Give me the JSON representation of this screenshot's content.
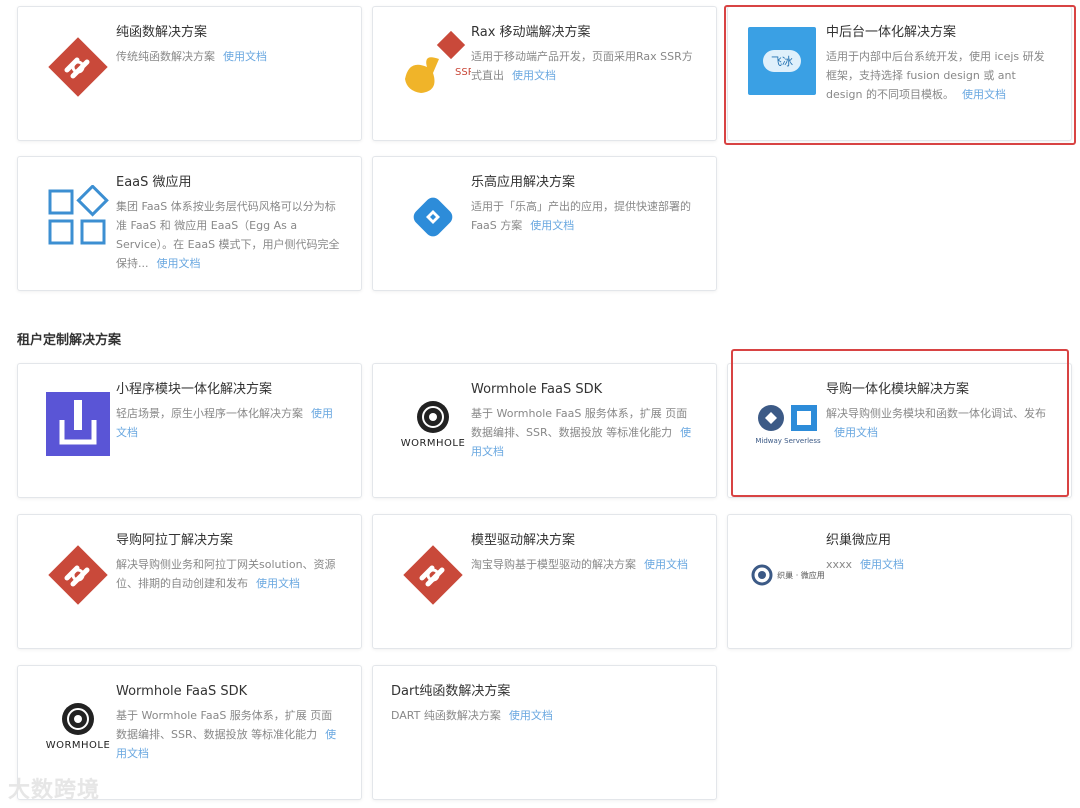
{
  "section_title": "租户定制解决方案",
  "doc_label": "使用文档",
  "cards": [
    {
      "title": "纯函数解决方案",
      "desc": "传统纯函数解决方案"
    },
    {
      "title": "Rax 移动端解决方案",
      "desc": "适用于移动端产品开发，页面采用Rax SSR方式直出",
      "logo_text": "SSR"
    },
    {
      "title": "中后台一体化解决方案",
      "desc": "适用于内部中后台系统开发，使用 icejs 研发框架，支持选择 fusion design 或 ant design 的不同项目模板。",
      "logo_text": "飞冰"
    },
    {
      "title": "EaaS 微应用",
      "desc": "集团 FaaS 体系按业务层代码风格可以分为标准 FaaS 和 微应用 EaaS（Egg As a Service）。在 EaaS 模式下，用户侧代码完全保持..."
    },
    {
      "title": "乐高应用解决方案",
      "desc": "适用于「乐高」产出的应用，提供快速部署的 FaaS 方案"
    },
    {
      "title": "小程序模块一体化解决方案",
      "desc": "轻店场景，原生小程序一体化解决方案"
    },
    {
      "title": "Wormhole FaaS SDK",
      "desc": "基于 Wormhole FaaS 服务体系，扩展 页面数据编排、SSR、数据投放 等标准化能力",
      "logo_text": "WORMHOLE"
    },
    {
      "title": "导购一体化模块解决方案",
      "desc": "解决导购侧业务模块和函数一体化调试、发布",
      "logo_text": "Midway Serverless"
    },
    {
      "title": "导购阿拉丁解决方案",
      "desc": "解决导购侧业务和阿拉丁网关solution、资源位、排期的自动创建和发布"
    },
    {
      "title": "模型驱动解决方案",
      "desc": "淘宝导购基于模型驱动的解决方案"
    },
    {
      "title": "织巢微应用",
      "desc": "xxxx",
      "logo_text": "织巢 · 微应用"
    },
    {
      "title": "Wormhole FaaS SDK",
      "desc": "基于 Wormhole FaaS 服务体系，扩展 页面数据编排、SSR、数据投放 等标准化能力",
      "logo_text": "WORMHOLE"
    },
    {
      "title": "Dart纯函数解决方案",
      "desc": "DART 纯函数解决方案"
    }
  ],
  "watermark": "大数跨境",
  "colors": {
    "highlight": "#d84343",
    "link": "#69a7e0",
    "brand_red": "#c9493a",
    "blue": "#2d8cd9"
  }
}
